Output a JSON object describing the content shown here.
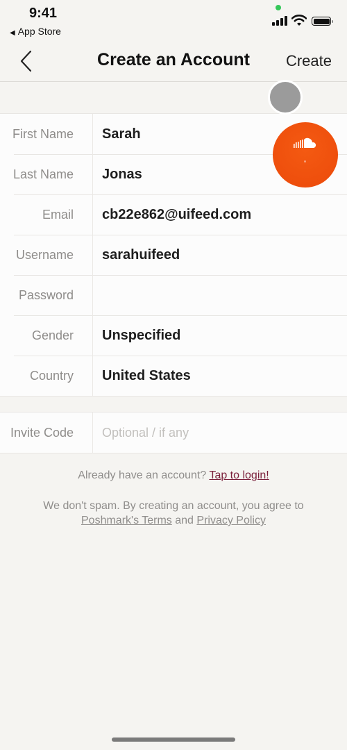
{
  "status_bar": {
    "time": "9:41",
    "back_app": "App Store",
    "back_icon": "triangle-left-icon",
    "icons": [
      "signal-icon",
      "wifi-icon",
      "battery-icon"
    ]
  },
  "nav": {
    "back_icon": "chevron-left-icon",
    "title": "Create an Account",
    "action": "Create"
  },
  "form": {
    "fields": [
      {
        "label": "First Name",
        "value": "Sarah"
      },
      {
        "label": "Last Name",
        "value": "Jonas"
      },
      {
        "label": "Email",
        "value": "cb22e862@uifeed.com"
      },
      {
        "label": "Username",
        "value": "sarahuifeed"
      },
      {
        "label": "Password",
        "value": ""
      },
      {
        "label": "Gender",
        "value": "Unspecified"
      },
      {
        "label": "Country",
        "value": "United States"
      }
    ],
    "invite": {
      "label": "Invite Code",
      "placeholder": "Optional / if any"
    }
  },
  "footer": {
    "login_prompt": "Already have an account?",
    "login_link": "Tap to login!",
    "terms_text": "We don't spam. By creating an account, you agree to",
    "terms_link": "Poshmark's Terms",
    "and": "and",
    "privacy_link": "Privacy Policy"
  },
  "overlays": {
    "gray_bubble_icon": "assistive-touch-icon",
    "soundcloud_icon": "soundcloud-icon"
  },
  "colors": {
    "background": "#f5f4f1",
    "login_link": "#7a1f3a",
    "soundcloud": "#f45a12"
  }
}
